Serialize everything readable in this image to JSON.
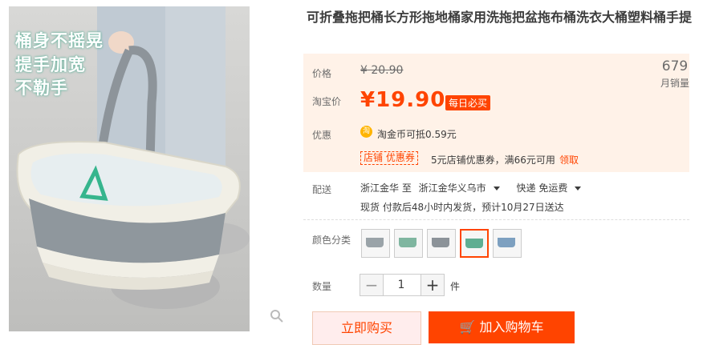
{
  "image": {
    "overlay_lines": [
      "桶身不摇晃",
      "提手加宽",
      "不勒手"
    ]
  },
  "title": "可折叠拖把桶长方形拖地桶家用洗拖把盆拖布桶洗衣大桶塑料桶手提",
  "price": {
    "label": "价格",
    "original": "¥ 20.90",
    "sale_label": "淘宝价",
    "sale": "¥19.90",
    "badge": "每日必买"
  },
  "sales": {
    "count": "679",
    "unit": "月销量"
  },
  "promo": {
    "label": "优惠",
    "coin_glyph": "淘",
    "coin_text": "淘金币可抵0.59元",
    "shop_coupon_tag": "店铺 优惠券",
    "coupon_text": "5元店铺优惠券，满66元可用",
    "claim": "领取"
  },
  "shipping": {
    "label": "配送",
    "from": "浙江金华 至",
    "to": "浙江金华义乌市",
    "method": "快递 免运费",
    "detail": "现货 付款后48小时内发货，预计10月27日送达"
  },
  "color": {
    "label": "颜色分类",
    "swatches": [
      {
        "name": "gray-white",
        "color": "#9aa3a8"
      },
      {
        "name": "green",
        "color": "#7fb6a0"
      },
      {
        "name": "gray",
        "color": "#8c9399"
      },
      {
        "name": "teal-selected",
        "color": "#5fae92"
      },
      {
        "name": "blue-gray",
        "color": "#7da0c0"
      }
    ]
  },
  "quantity": {
    "label": "数量",
    "minus": "−",
    "value": "1",
    "plus": "+",
    "unit": "件"
  },
  "actions": {
    "buy_now": "立即购买",
    "add_to_cart": "加入购物车"
  },
  "colors": {
    "accent": "#ff4400",
    "panel_bg": "#fff2e8"
  }
}
